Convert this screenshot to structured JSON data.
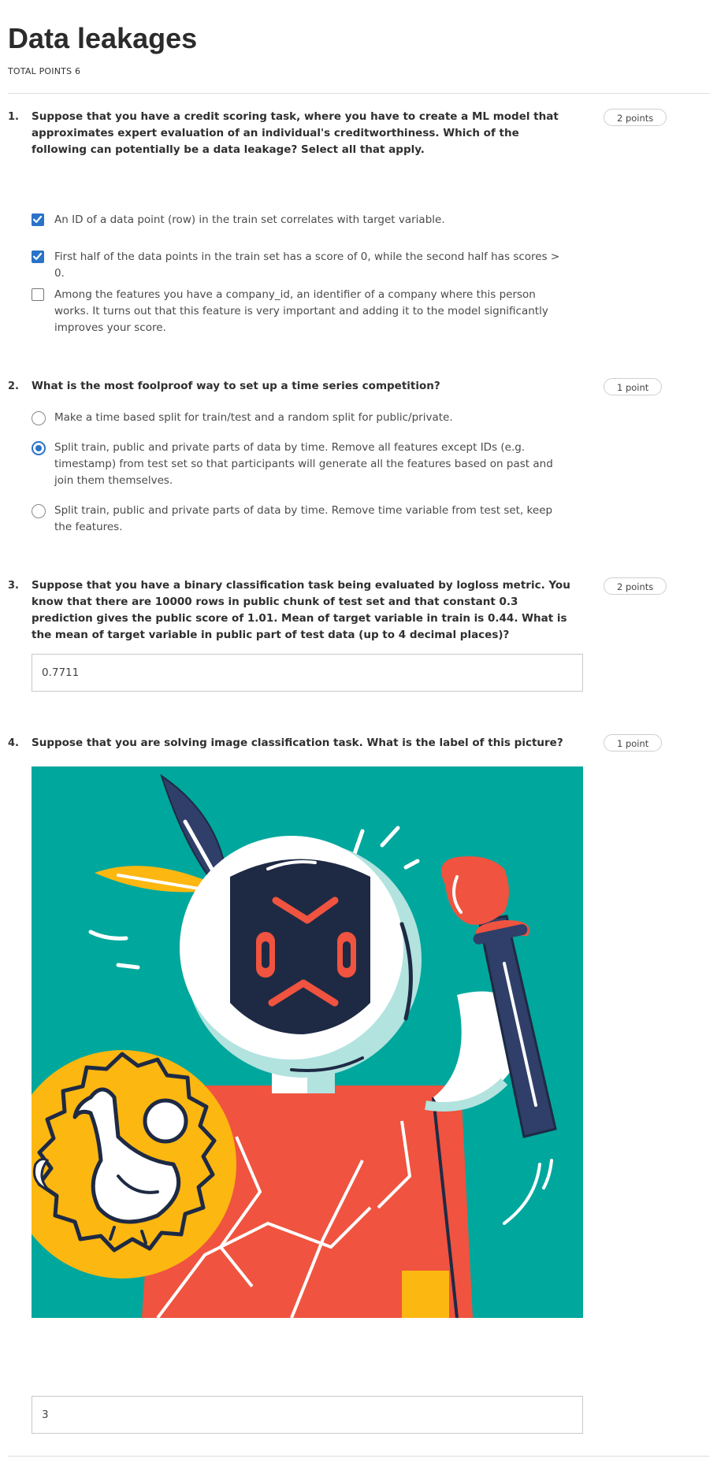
{
  "page": {
    "title": "Data leakages",
    "total_points": "TOTAL POINTS 6"
  },
  "questions": [
    {
      "number": "1.",
      "text": "Suppose that you have a credit scoring task, where you have to create a ML model that approximates expert evaluation of an individual's creditworthiness. Which of the following can potentially be a data leakage? Select all that apply.",
      "points": "2 points",
      "options": [
        {
          "label": "An ID of a data point (row) in the train set correlates with target variable.",
          "checked": true
        },
        {
          "label": "First half of the data points in the train set has a score of 0, while the second half has scores > 0.",
          "checked": true
        },
        {
          "label": "Among the features you have a company_id, an identifier of a company where this person works. It turns out that this feature is very important and adding it to the model significantly improves your score.",
          "checked": false
        }
      ]
    },
    {
      "number": "2.",
      "text": "What is the most foolproof way to set up a time series competition?",
      "points": "1 point",
      "options": [
        {
          "label": "Make a time based split for train/test and a random split for public/private.",
          "selected": false
        },
        {
          "label": "Split train, public and private parts of data by time. Remove all features except IDs (e.g. timestamp) from test set so that participants will generate all the features based on past and join them themselves.",
          "selected": true
        },
        {
          "label": "Split train, public and private parts of data by time. Remove time variable from test set, keep the features.",
          "selected": false
        }
      ]
    },
    {
      "number": "3.",
      "text": "Suppose that you have a binary classification task being evaluated by logloss metric. You know that there are 10000 rows in public chunk of test set and that constant 0.3 prediction gives the public score of 1.01. Mean of target variable in train is 0.44. What is the mean of target variable in public part of test data (up to 4 decimal places)?",
      "points": "2 points",
      "answer": "0.7711"
    },
    {
      "number": "4.",
      "text": "Suppose that you are solving image classification task. What is the label of this picture?",
      "points": "1 point",
      "answer": "3"
    }
  ],
  "colors": {
    "accent": "#2a73c8",
    "illustration_bg": "#00a79d",
    "illustration_red": "#f0533f",
    "illustration_yellow": "#fcb711",
    "illustration_navy": "#1e2a44"
  }
}
